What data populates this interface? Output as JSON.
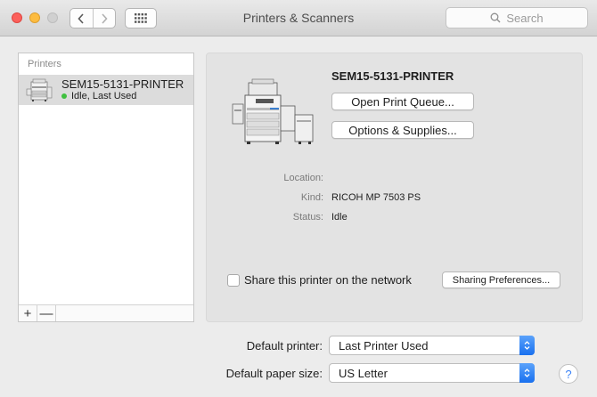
{
  "window": {
    "title": "Printers & Scanners"
  },
  "search": {
    "placeholder": "Search"
  },
  "printers_list": {
    "header": "Printers",
    "items": [
      {
        "name": "SEM15-5131-PRINTER",
        "status": "Idle, Last Used",
        "status_color": "#3fc03f",
        "selected": true
      }
    ],
    "add_label": "+",
    "remove_label": "—"
  },
  "detail": {
    "printer_name": "SEM15-5131-PRINTER",
    "open_queue_label": "Open Print Queue...",
    "options_supplies_label": "Options & Supplies...",
    "location_label": "Location:",
    "location_value": "",
    "kind_label": "Kind:",
    "kind_value": "RICOH MP 7503 PS",
    "status_label": "Status:",
    "status_value": "Idle",
    "share_label": "Share this printer on the network",
    "share_checked": false,
    "sharing_prefs_label": "Sharing Preferences..."
  },
  "defaults": {
    "default_printer_label": "Default printer:",
    "default_printer_value": "Last Printer Used",
    "paper_size_label": "Default paper size:",
    "paper_size_value": "US Letter"
  },
  "help": {
    "label": "?"
  },
  "colors": {
    "accent": "#1970ef",
    "selection": "#dcdcdc"
  }
}
